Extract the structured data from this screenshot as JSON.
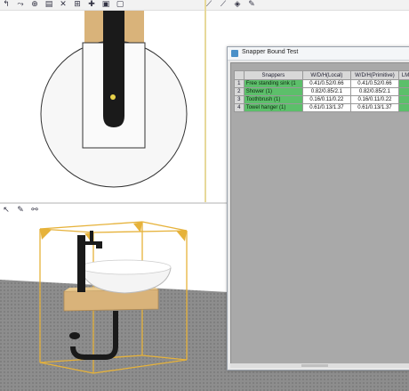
{
  "top_toolbar": {
    "icons": [
      "move-icon",
      "link-icon",
      "snap-icon",
      "undo-icon",
      "delete-icon",
      "grid-icon",
      "add-icon",
      "layer-icon",
      "info-icon"
    ],
    "glyphs": [
      "↰",
      "⤳",
      "⊕",
      "▤",
      "✕",
      "⊞",
      "✚",
      "▣",
      "▢"
    ]
  },
  "top_toolbar_right": {
    "icons": [
      "tool-a-icon",
      "tool-b-icon",
      "tool-c-icon",
      "tool-d-icon"
    ],
    "glyphs": [
      "⟋",
      "⟋",
      "◈",
      "✎"
    ]
  },
  "bottom_toolbar": {
    "icons": [
      "cursor-icon",
      "wand-icon",
      "chain-icon"
    ],
    "glyphs": [
      "↖",
      "✎",
      "⚯"
    ]
  },
  "dialog": {
    "title": "Snapper Bound Test",
    "columns": [
      "Snappers",
      "W/D/H(Local)",
      "W/D/H(Primitive)",
      "LM"
    ],
    "rows": [
      {
        "num": "1",
        "name": "Free standing sink (1",
        "local": "0.41/0.52/0.66",
        "primitive": "0.41/0.52/0.66"
      },
      {
        "num": "2",
        "name": "Shower (1)",
        "local": "0.82/0.85/2.1",
        "primitive": "0.82/0.85/2.1"
      },
      {
        "num": "3",
        "name": "Toothbrush (1)",
        "local": "0.16/0.11/0.22",
        "primitive": "0.16/0.11/0.22"
      },
      {
        "num": "4",
        "name": "Towel hanger (1)",
        "local": "0.61/0.13/1.37",
        "primitive": "0.61/0.13/1.37"
      }
    ]
  },
  "colors": {
    "wood": "#d9b37a",
    "faucet": "#1a1a1a",
    "frame": "#e6b23a",
    "row_green": "#5cbf6a",
    "floor": "#8a8a8a"
  }
}
